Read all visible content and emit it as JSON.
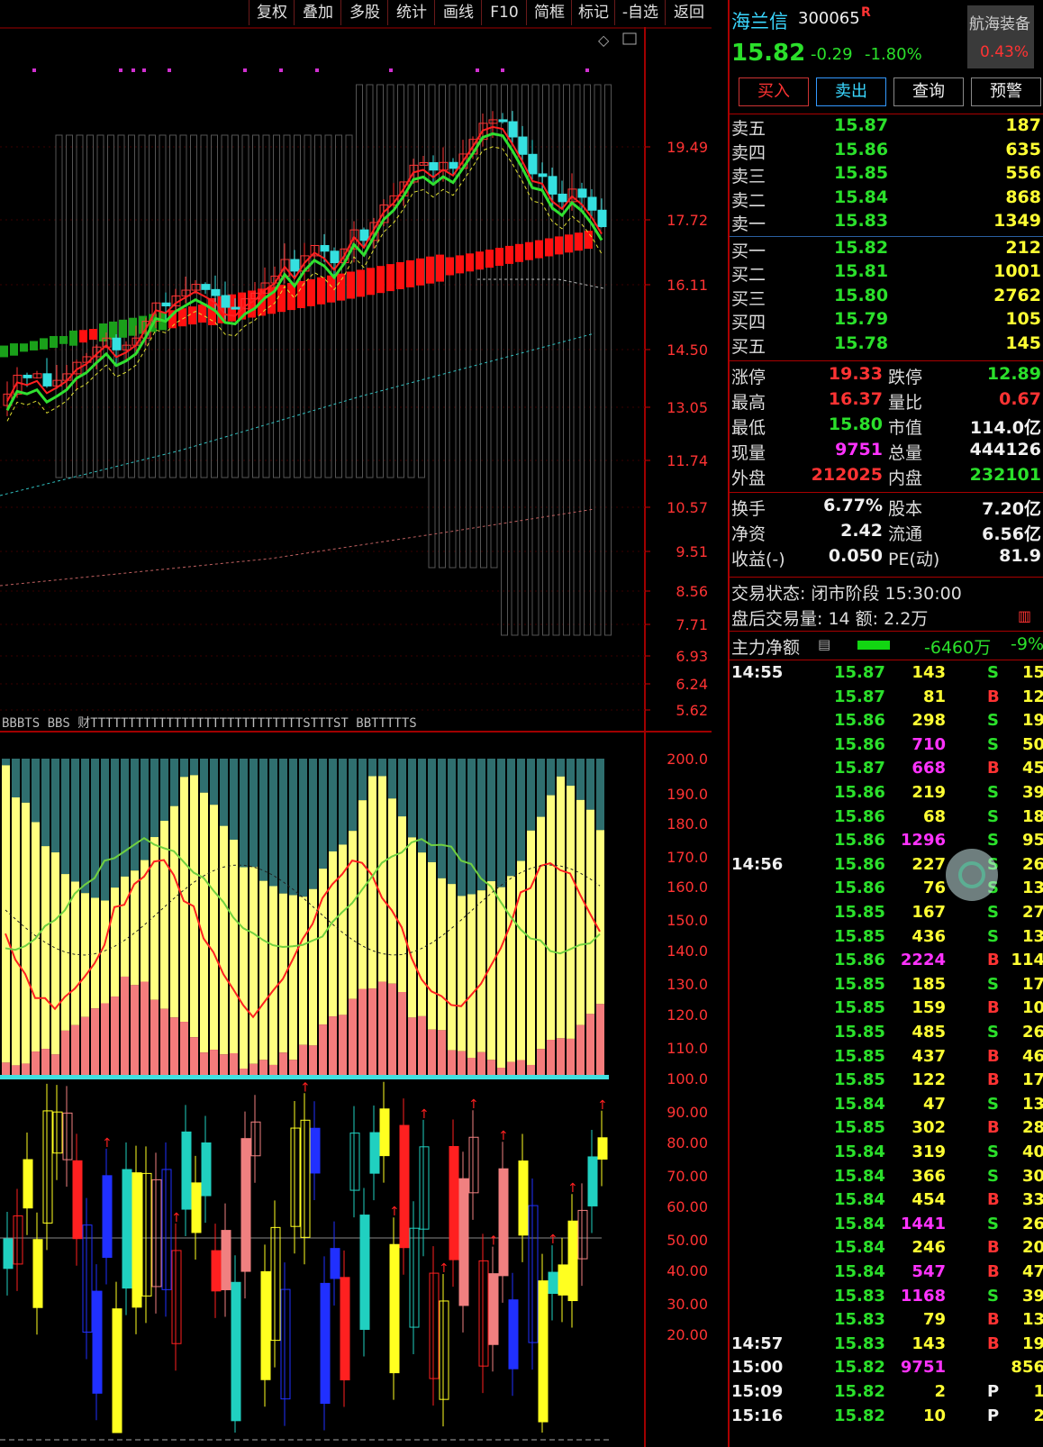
{
  "toolbar": [
    "复权",
    "叠加",
    "多股",
    "统计",
    "画线",
    "F10",
    "简框",
    "标记",
    "-自选",
    "返回"
  ],
  "price_axis": [
    "19.49",
    "17.72",
    "16.11",
    "14.50",
    "13.05",
    "11.74",
    "10.57",
    "9.51",
    "8.56",
    "7.71",
    "6.93",
    "6.24",
    "5.62"
  ],
  "vol_axis": [
    "200.0",
    "190.0",
    "180.0",
    "170.0",
    "160.0",
    "150.0",
    "140.0",
    "130.0",
    "120.0",
    "110.0",
    "100.0",
    "90.00",
    "80.00",
    "70.00",
    "60.00",
    "50.00",
    "40.00",
    "30.00",
    "20.00"
  ],
  "signal_bar": "BBBTS  BBS 财TTTTTTTTTTTTTTTTTTTTTTTTTTTTSTTTST BBTTTTTS",
  "stock": {
    "name": "海兰信",
    "code": "300065",
    "flag": "R",
    "price": "15.82",
    "change": "-0.29",
    "change_pct": "-1.80%",
    "related_name": "航海装备",
    "related_pct": "0.43%"
  },
  "actions": {
    "buy": "买入",
    "sell": "卖出",
    "query": "查询",
    "alert": "预警"
  },
  "asks": [
    {
      "label": "卖五",
      "price": "15.87",
      "vol": "187"
    },
    {
      "label": "卖四",
      "price": "15.86",
      "vol": "635"
    },
    {
      "label": "卖三",
      "price": "15.85",
      "vol": "556"
    },
    {
      "label": "卖二",
      "price": "15.84",
      "vol": "868"
    },
    {
      "label": "卖一",
      "price": "15.83",
      "vol": "1349"
    }
  ],
  "bids": [
    {
      "label": "买一",
      "price": "15.82",
      "vol": "212"
    },
    {
      "label": "买二",
      "price": "15.81",
      "vol": "1001"
    },
    {
      "label": "买三",
      "price": "15.80",
      "vol": "2762"
    },
    {
      "label": "买四",
      "price": "15.79",
      "vol": "105"
    },
    {
      "label": "买五",
      "price": "15.78",
      "vol": "145"
    }
  ],
  "stats": [
    {
      "l1": "涨停",
      "v1": "19.33",
      "l2": "跌停",
      "v2": "12.89"
    },
    {
      "l1": "最高",
      "v1": "16.37",
      "l2": "量比",
      "v2": "0.67"
    },
    {
      "l1": "最低",
      "v1": "15.80",
      "l2": "市值",
      "v2": "114.0亿"
    },
    {
      "l1": "现量",
      "v1": "9751",
      "l2": "总量",
      "v2": "444126"
    },
    {
      "l1": "外盘",
      "v1": "212025",
      "l2": "内盘",
      "v2": "232101"
    }
  ],
  "stats2": [
    {
      "l1": "换手",
      "v1": "6.77%",
      "l2": "股本",
      "v2": "7.20亿"
    },
    {
      "l1": "净资",
      "v1": "2.42",
      "l2": "流通",
      "v2": "6.56亿"
    },
    {
      "l1": "收益(-)",
      "v1": "0.050",
      "l2": "PE(动)",
      "v2": "81.9"
    }
  ],
  "status": {
    "line1": "交易状态: 闭市阶段 15:30:00",
    "line2": "盘后交易量: 14  额: 2.2万",
    "main_flow_label": "主力净额",
    "main_flow_value": "-6460万",
    "main_flow_pct": "-9%"
  },
  "trades": [
    {
      "t": "14:55",
      "p": "15.87",
      "v": "143",
      "s": "S",
      "n": "15"
    },
    {
      "t": "",
      "p": "15.87",
      "v": "81",
      "s": "B",
      "n": "12"
    },
    {
      "t": "",
      "p": "15.86",
      "v": "298",
      "s": "S",
      "n": "19"
    },
    {
      "t": "",
      "p": "15.86",
      "v": "710",
      "s": "S",
      "n": "50"
    },
    {
      "t": "",
      "p": "15.87",
      "v": "668",
      "s": "B",
      "n": "45"
    },
    {
      "t": "",
      "p": "15.86",
      "v": "219",
      "s": "S",
      "n": "39"
    },
    {
      "t": "",
      "p": "15.86",
      "v": "68",
      "s": "S",
      "n": "18"
    },
    {
      "t": "",
      "p": "15.86",
      "v": "1296",
      "s": "S",
      "n": "95"
    },
    {
      "t": "14:56",
      "p": "15.86",
      "v": "227",
      "s": "S",
      "n": "26"
    },
    {
      "t": "",
      "p": "15.86",
      "v": "76",
      "s": "S",
      "n": "13"
    },
    {
      "t": "",
      "p": "15.85",
      "v": "167",
      "s": "S",
      "n": "27"
    },
    {
      "t": "",
      "p": "15.85",
      "v": "436",
      "s": "S",
      "n": "13"
    },
    {
      "t": "",
      "p": "15.86",
      "v": "2224",
      "s": "B",
      "n": "114"
    },
    {
      "t": "",
      "p": "15.85",
      "v": "185",
      "s": "S",
      "n": "17"
    },
    {
      "t": "",
      "p": "15.85",
      "v": "159",
      "s": "B",
      "n": "10"
    },
    {
      "t": "",
      "p": "15.85",
      "v": "485",
      "s": "S",
      "n": "26"
    },
    {
      "t": "",
      "p": "15.85",
      "v": "437",
      "s": "B",
      "n": "46"
    },
    {
      "t": "",
      "p": "15.85",
      "v": "122",
      "s": "B",
      "n": "17"
    },
    {
      "t": "",
      "p": "15.84",
      "v": "47",
      "s": "S",
      "n": "13"
    },
    {
      "t": "",
      "p": "15.85",
      "v": "302",
      "s": "B",
      "n": "28"
    },
    {
      "t": "",
      "p": "15.84",
      "v": "319",
      "s": "S",
      "n": "40"
    },
    {
      "t": "",
      "p": "15.84",
      "v": "366",
      "s": "S",
      "n": "30"
    },
    {
      "t": "",
      "p": "15.84",
      "v": "454",
      "s": "B",
      "n": "33"
    },
    {
      "t": "",
      "p": "15.84",
      "v": "1441",
      "s": "S",
      "n": "26"
    },
    {
      "t": "",
      "p": "15.84",
      "v": "246",
      "s": "B",
      "n": "20"
    },
    {
      "t": "",
      "p": "15.84",
      "v": "547",
      "s": "B",
      "n": "47"
    },
    {
      "t": "",
      "p": "15.83",
      "v": "1168",
      "s": "S",
      "n": "39"
    },
    {
      "t": "",
      "p": "15.83",
      "v": "79",
      "s": "B",
      "n": "13"
    },
    {
      "t": "14:57",
      "p": "15.83",
      "v": "143",
      "s": "B",
      "n": "19"
    },
    {
      "t": "15:00",
      "p": "15.82",
      "v": "9751",
      "s": "",
      "n": "856"
    },
    {
      "t": "15:09",
      "p": "15.82",
      "v": "2",
      "s": "P",
      "n": "1"
    },
    {
      "t": "15:16",
      "p": "15.82",
      "v": "10",
      "s": "P",
      "n": "2"
    }
  ],
  "colors": {
    "up": "#ff3333",
    "down": "#2be02b",
    "frame": "#a00000",
    "yellowbar": "#ffff80",
    "pinkbar": "#f47c7c",
    "tealbar": "#2f6f6f"
  }
}
